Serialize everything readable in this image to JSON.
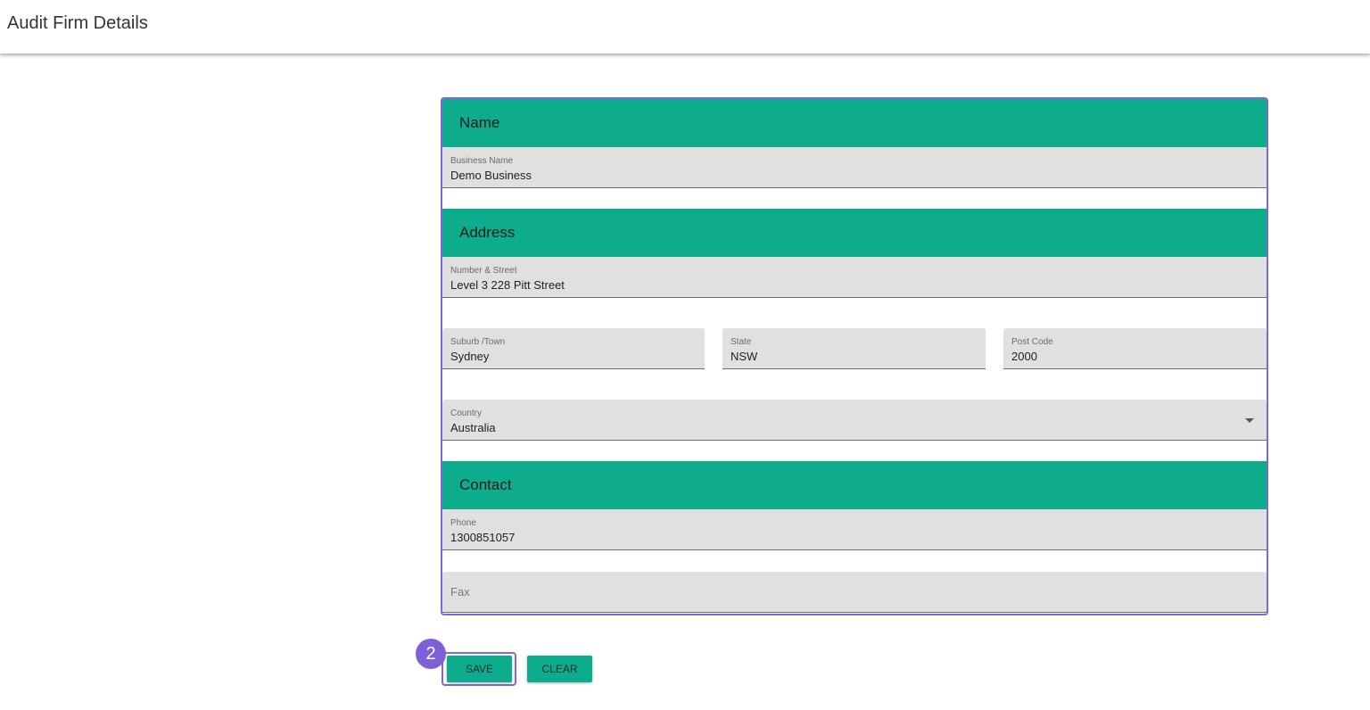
{
  "header": {
    "title": "Audit Firm Details"
  },
  "sections": {
    "name": {
      "title": "Name"
    },
    "address": {
      "title": "Address"
    },
    "contact": {
      "title": "Contact"
    }
  },
  "fields": {
    "business_name": {
      "label": "Business Name",
      "value": "Demo Business"
    },
    "street": {
      "label": "Number & Street",
      "value": "Level 3 228 Pitt Street"
    },
    "suburb": {
      "label": "Suburb /Town",
      "value": "Sydney"
    },
    "state": {
      "label": "State",
      "value": "NSW"
    },
    "postcode": {
      "label": "Post Code",
      "value": "2000"
    },
    "country": {
      "label": "Country",
      "value": "Australia",
      "icon": "chevron-down-icon"
    },
    "phone": {
      "label": "Phone",
      "value": "1300851057"
    },
    "fax": {
      "placeholder": "Fax",
      "value": ""
    }
  },
  "actions": {
    "save_label": "SAVE",
    "clear_label": "CLEAR"
  },
  "annotation": {
    "step_number": "2"
  },
  "colors": {
    "accent": "#0dac8c",
    "highlight": "#8066e0"
  }
}
